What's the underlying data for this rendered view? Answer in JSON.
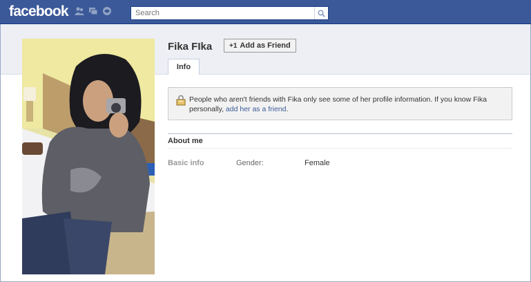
{
  "header": {
    "logo": "facebook",
    "search_placeholder": "Search",
    "icons": [
      "friend-requests-icon",
      "messages-icon",
      "notifications-icon",
      "search-icon"
    ]
  },
  "profile": {
    "name": "Fika FIka",
    "add_friend_label": "Add as Friend",
    "tabs": [
      {
        "label": "Info"
      }
    ]
  },
  "notice": {
    "text_before": "People who aren't friends with Fika only see some of her profile information. If you know Fika personally, ",
    "link": "add her as a friend",
    "text_after": "."
  },
  "about": {
    "title": "About me",
    "section": "Basic info",
    "fields": [
      {
        "label": "Gender:",
        "value": "Female"
      }
    ]
  },
  "colors": {
    "brand_blue": "#3b5998",
    "header_band": "#edeff4",
    "link": "#3b5998"
  }
}
